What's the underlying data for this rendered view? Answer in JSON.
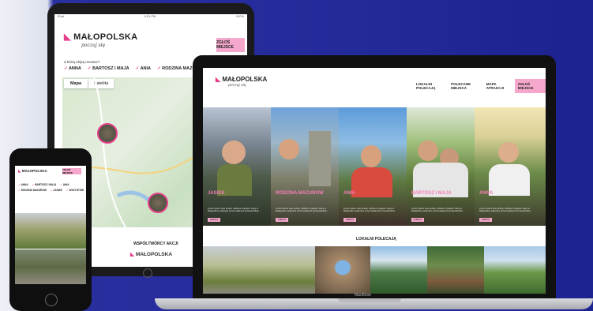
{
  "tablet": {
    "status_left": "iPad",
    "status_time": "4:31 PM",
    "status_right": "100%",
    "logo_text": "MAŁOPOLSKA",
    "tagline": "poczuj się",
    "cta_label": "ZGŁOŚ MIEJSCE",
    "filter_label": "Z którą ekipą ruszasz?",
    "checks": [
      "ANNA",
      "BARTOSZ I MAJA",
      "ANIA",
      "RODZINA MAZUR"
    ],
    "map_tabs": [
      "Mapa",
      "Satelita"
    ],
    "bottom_title": "WSPÓŁTWÓRCY AKCJI",
    "bottom_logo": "MAŁOPOLSKA"
  },
  "phone": {
    "logo_text": "MAŁOPOLSKA",
    "cta_label": "ZGŁOŚ MIEJSCE",
    "checks": [
      "ANNA",
      "BARTOSZ I MAJA",
      "ANIA",
      "RODZINA MAZURÓW",
      "JASIEK",
      "WSZYSTKIE"
    ]
  },
  "laptop": {
    "logo_text": "MAŁOPOLSKA",
    "tagline": "poczuj się",
    "nav": [
      "LOKALNI POLECAJĄ",
      "POLECANE MIEJSCA",
      "MAPA ATRAKCJI"
    ],
    "cta_label": "ZGŁOŚ MIEJSCE",
    "heroes": [
      {
        "name": "JASIEK",
        "desc": "Lorem ipsum opis profilu, ulubione miejsca i trasy w Małopolsce polecane przez lokalnych przewodników.",
        "btn": "ZOBACZ"
      },
      {
        "name": "RODZINA MAZURÓW",
        "desc": "Lorem ipsum opis profilu, ulubione miejsca i trasy w Małopolsce polecane przez lokalnych przewodników.",
        "btn": "ZOBACZ"
      },
      {
        "name": "ANIA",
        "desc": "Lorem ipsum opis profilu, ulubione miejsca i trasy w Małopolsce polecane przez lokalnych przewodników.",
        "btn": "ZOBACZ"
      },
      {
        "name": "BARTOSZ I MAJA",
        "desc": "Lorem ipsum opis profilu, ulubione miejsca i trasy w Małopolsce polecane przez lokalnych przewodników.",
        "btn": "ZOBACZ"
      },
      {
        "name": "ANNA",
        "desc": "Lorem ipsum opis profilu, ulubione miejsca i trasy w Małopolsce polecane przez lokalnych przewodników.",
        "btn": "ZOBACZ"
      }
    ],
    "section_title": "LOKALNI POLECAJĄ",
    "macbook_label": "MacBook"
  },
  "colors": {
    "brand_pink": "#e83f8c",
    "cta_pink": "#f6a8cc",
    "background_blue": "#232a9a"
  }
}
